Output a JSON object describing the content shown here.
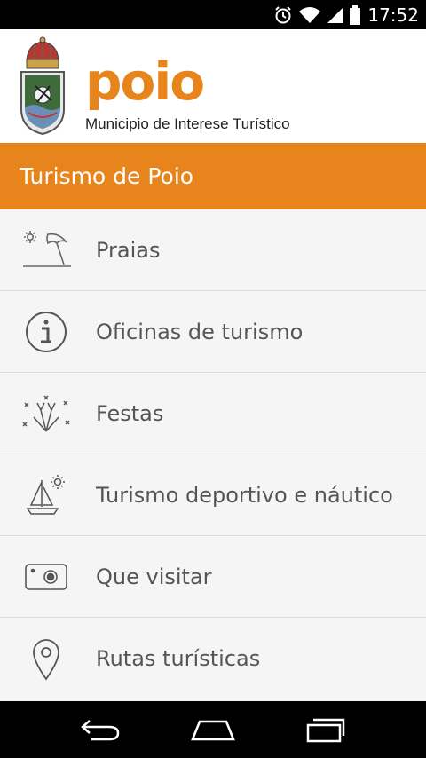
{
  "status_bar": {
    "time": "17:52",
    "icons": [
      "alarm-icon",
      "wifi-icon",
      "signal-icon",
      "battery-icon"
    ]
  },
  "header": {
    "logo_text": "poio",
    "subtitle": "Municipio de Interese Turístico",
    "brand_color": "#e8841c"
  },
  "title_bar": {
    "title": "Turismo de Poio"
  },
  "menu": {
    "items": [
      {
        "label": "Praias",
        "icon": "beach-umbrella-icon"
      },
      {
        "label": "Oficinas de turismo",
        "icon": "info-icon"
      },
      {
        "label": "Festas",
        "icon": "fireworks-icon"
      },
      {
        "label": "Turismo deportivo e náutico",
        "icon": "sailboat-icon"
      },
      {
        "label": "Que visitar",
        "icon": "camera-icon"
      },
      {
        "label": "Rutas turísticas",
        "icon": "map-pin-icon"
      }
    ]
  },
  "nav_bar": {
    "buttons": [
      "back-icon",
      "home-icon",
      "recents-icon"
    ]
  }
}
